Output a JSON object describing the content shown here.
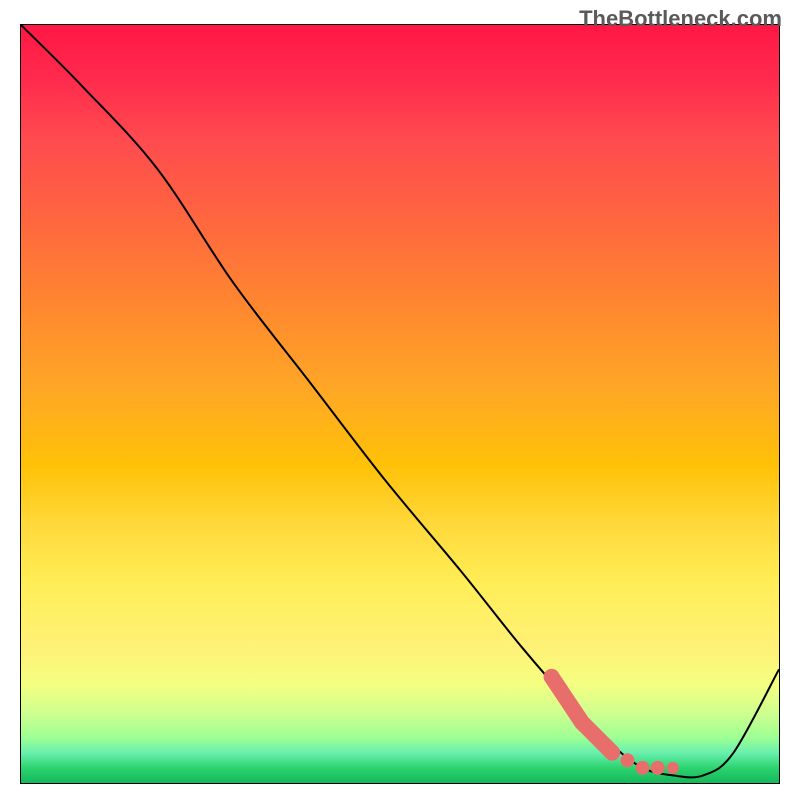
{
  "watermark": "TheBottleneck.com",
  "chart_data": {
    "type": "line",
    "title": "",
    "xlabel": "",
    "ylabel": "",
    "xlim": [
      0,
      100
    ],
    "ylim": [
      0,
      100
    ],
    "grid": false,
    "background": "heat-gradient-red-to-green",
    "series": [
      {
        "name": "bottleneck-curve",
        "stroke": "#000000",
        "x": [
          0,
          8,
          18,
          28,
          38,
          48,
          58,
          66,
          73,
          78,
          82,
          86,
          90,
          94,
          100
        ],
        "y": [
          100,
          92,
          81,
          66,
          53,
          40,
          28,
          18,
          10,
          5,
          2,
          1,
          1,
          4,
          15
        ]
      }
    ],
    "highlight_segment": {
      "name": "optimal-range-marker",
      "color": "#e86e6b",
      "x": [
        70,
        72,
        74,
        76,
        78,
        80,
        82,
        84,
        86
      ],
      "y": [
        14,
        11,
        8,
        6,
        4,
        3,
        2,
        2,
        2
      ]
    }
  }
}
